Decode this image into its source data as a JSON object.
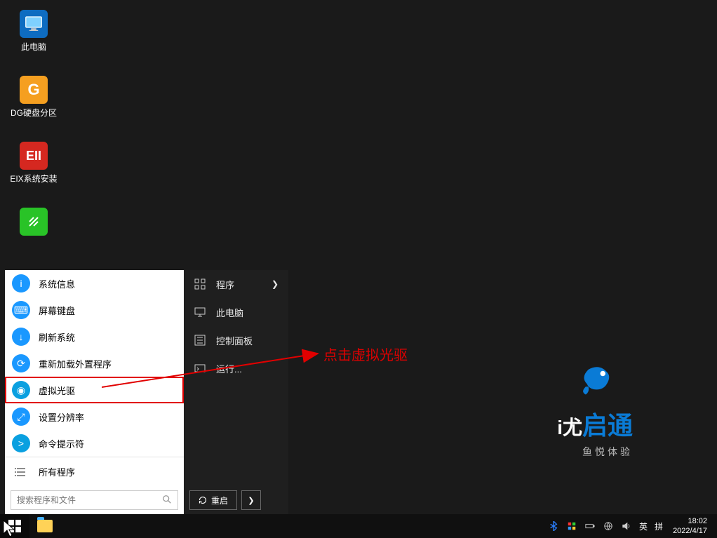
{
  "desktop": {
    "icons": [
      {
        "label": "此电脑"
      },
      {
        "label": "DG硬盘分区"
      },
      {
        "label": "EIX系统安装"
      },
      {
        "label": ""
      }
    ]
  },
  "startmenu": {
    "left": [
      {
        "label": "系统信息",
        "color": "#1a98ff",
        "glyph": "i"
      },
      {
        "label": "屏幕键盘",
        "color": "#1a98ff",
        "glyph": "⌨"
      },
      {
        "label": "刷新系统",
        "color": "#1a98ff",
        "glyph": "↻"
      },
      {
        "label": "重新加载外置程序",
        "color": "#1a98ff",
        "glyph": "⟳"
      },
      {
        "label": "虚拟光驱",
        "color": "#0aa0e0",
        "glyph": "◉"
      },
      {
        "label": "设置分辨率",
        "color": "#1a98ff",
        "glyph": "⚙"
      },
      {
        "label": "命令提示符",
        "color": "#0aa0e0",
        "glyph": ">"
      }
    ],
    "all_programs": "所有程序",
    "search_placeholder": "搜索程序和文件",
    "right": [
      {
        "label": "程序",
        "has_sub": true
      },
      {
        "label": "此电脑",
        "has_sub": false
      },
      {
        "label": "控制面板",
        "has_sub": false
      },
      {
        "label": "运行...",
        "has_sub": false
      }
    ],
    "restart": "重启"
  },
  "annotation": {
    "text": "点击虚拟光驱"
  },
  "brand": {
    "main1": "i尤",
    "main2": "启通",
    "sub": "鱼悦体验"
  },
  "taskbar": {
    "ime1": "英",
    "ime2": "拼",
    "time": "18:02",
    "date": "2022/4/17"
  }
}
